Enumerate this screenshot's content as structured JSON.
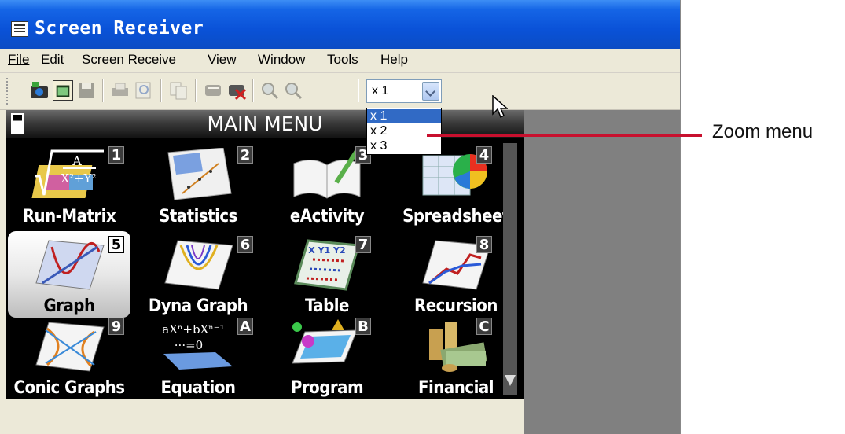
{
  "window": {
    "title": "Screen Receiver",
    "icon": "app-window-icon"
  },
  "menubar": {
    "items": [
      {
        "label": "File"
      },
      {
        "label": "Edit"
      },
      {
        "label": "Screen Receive"
      },
      {
        "label": "View"
      },
      {
        "label": "Window"
      },
      {
        "label": "Tools"
      },
      {
        "label": "Help"
      }
    ]
  },
  "toolbar": {
    "buttons": [
      "camera-icon",
      "new-window-icon",
      "save-icon",
      "print-icon",
      "print-preview-icon",
      "copy-icon",
      "receive-icon",
      "stop-receive-icon",
      "zoom-in-icon",
      "zoom-out-icon"
    ],
    "zoom_value": "x 1"
  },
  "zoom_dropdown": {
    "options": [
      "x 1",
      "x 2",
      "x 3"
    ],
    "selected": "x 1"
  },
  "calculator": {
    "title": "MAIN MENU",
    "apps": [
      {
        "label": "Run-Matrix",
        "key": "1",
        "icon": "run-matrix-icon"
      },
      {
        "label": "Statistics",
        "key": "2",
        "icon": "statistics-icon"
      },
      {
        "label": "eActivity",
        "key": "3",
        "icon": "eactivity-icon"
      },
      {
        "label": "Spreadsheet",
        "key": "4",
        "icon": "spreadsheet-icon"
      },
      {
        "label": "Graph",
        "key": "5",
        "icon": "graph-icon",
        "selected": true
      },
      {
        "label": "Dyna Graph",
        "key": "6",
        "icon": "dyna-graph-icon"
      },
      {
        "label": "Table",
        "key": "7",
        "icon": "table-icon"
      },
      {
        "label": "Recursion",
        "key": "8",
        "icon": "recursion-icon"
      },
      {
        "label": "Conic Graphs",
        "key": "9",
        "icon": "conic-graphs-icon"
      },
      {
        "label": "Equation",
        "key": "A",
        "icon": "equation-icon"
      },
      {
        "label": "Program",
        "key": "B",
        "icon": "program-icon"
      },
      {
        "label": "Financial",
        "key": "C",
        "icon": "financial-icon"
      }
    ],
    "runmatrix_glyph": {
      "top": "A",
      "bottom": "X²+Y²"
    },
    "equation_glyph": {
      "top": "aXⁿ+bXⁿ⁻¹",
      "bottom": "···=0"
    },
    "table_glyph": "X Y1 Y2"
  },
  "annotation": {
    "label": "Zoom menu"
  },
  "colors": {
    "titlebar": "#0a52d8",
    "selection": "#316ac5",
    "callout": "#c8102e",
    "workspace": "#808080"
  }
}
